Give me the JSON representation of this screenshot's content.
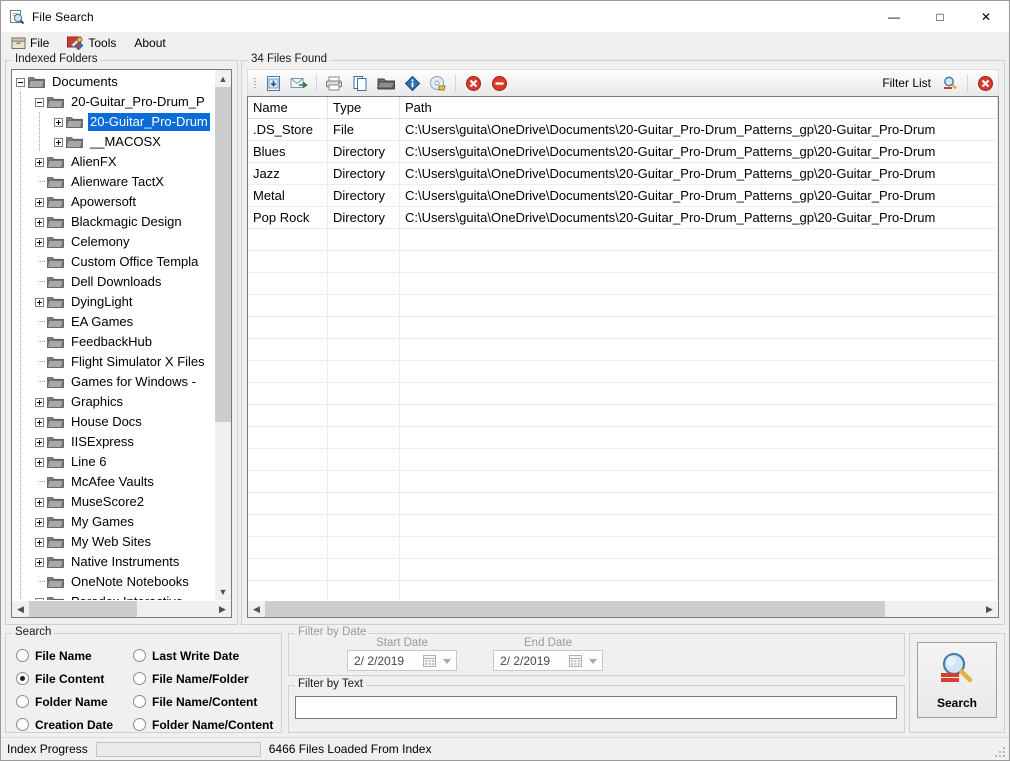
{
  "window": {
    "title": "File Search",
    "icon": "search-document-icon",
    "minimize": "—",
    "maximize": "□",
    "close": "✕"
  },
  "menu": {
    "items": [
      {
        "label": "File",
        "icon": "file-cabinet-icon"
      },
      {
        "label": "Tools",
        "icon": "tools-wrench-icon"
      },
      {
        "label": "About",
        "icon": ""
      }
    ]
  },
  "indexed_folders": {
    "legend": "Indexed Folders",
    "nodes": [
      {
        "label": "Documents",
        "depth": 0,
        "expander": "minus",
        "selected": false
      },
      {
        "label": "20-Guitar_Pro-Drum_P",
        "depth": 1,
        "expander": "minus",
        "selected": false
      },
      {
        "label": "20-Guitar_Pro-Drum",
        "depth": 2,
        "expander": "plus",
        "selected": true
      },
      {
        "label": "__MACOSX",
        "depth": 2,
        "expander": "plus",
        "selected": false
      },
      {
        "label": "AlienFX",
        "depth": 1,
        "expander": "plus",
        "selected": false
      },
      {
        "label": "Alienware TactX",
        "depth": 1,
        "expander": "none",
        "selected": false
      },
      {
        "label": "Apowersoft",
        "depth": 1,
        "expander": "plus",
        "selected": false
      },
      {
        "label": "Blackmagic Design",
        "depth": 1,
        "expander": "plus",
        "selected": false
      },
      {
        "label": "Celemony",
        "depth": 1,
        "expander": "plus",
        "selected": false
      },
      {
        "label": "Custom Office Templa",
        "depth": 1,
        "expander": "none",
        "selected": false
      },
      {
        "label": "Dell Downloads",
        "depth": 1,
        "expander": "none",
        "selected": false
      },
      {
        "label": "DyingLight",
        "depth": 1,
        "expander": "plus",
        "selected": false
      },
      {
        "label": "EA Games",
        "depth": 1,
        "expander": "none",
        "selected": false
      },
      {
        "label": "FeedbackHub",
        "depth": 1,
        "expander": "none",
        "selected": false
      },
      {
        "label": "Flight Simulator X Files",
        "depth": 1,
        "expander": "none",
        "selected": false
      },
      {
        "label": "Games for Windows -",
        "depth": 1,
        "expander": "none",
        "selected": false
      },
      {
        "label": "Graphics",
        "depth": 1,
        "expander": "plus",
        "selected": false
      },
      {
        "label": "House Docs",
        "depth": 1,
        "expander": "plus",
        "selected": false
      },
      {
        "label": "IISExpress",
        "depth": 1,
        "expander": "plus",
        "selected": false
      },
      {
        "label": "Line 6",
        "depth": 1,
        "expander": "plus",
        "selected": false
      },
      {
        "label": "McAfee Vaults",
        "depth": 1,
        "expander": "none",
        "selected": false
      },
      {
        "label": "MuseScore2",
        "depth": 1,
        "expander": "plus",
        "selected": false
      },
      {
        "label": "My Games",
        "depth": 1,
        "expander": "plus",
        "selected": false
      },
      {
        "label": "My Web Sites",
        "depth": 1,
        "expander": "plus",
        "selected": false
      },
      {
        "label": "Native Instruments",
        "depth": 1,
        "expander": "plus",
        "selected": false
      },
      {
        "label": "OneNote Notebooks",
        "depth": 1,
        "expander": "none",
        "selected": false
      },
      {
        "label": "Paradox Interactive",
        "depth": 1,
        "expander": "plus",
        "selected": false
      }
    ]
  },
  "results": {
    "legend": "34 Files Found",
    "toolbar": {
      "buttons": [
        {
          "name": "export-save-icon"
        },
        {
          "name": "email-send-icon"
        },
        {
          "name": "print-icon"
        },
        {
          "name": "copy-icon"
        },
        {
          "name": "open-folder-icon"
        },
        {
          "name": "properties-info-icon"
        },
        {
          "name": "disc-burn-icon"
        },
        {
          "name": "delete-x-icon"
        },
        {
          "name": "remove-minus-icon"
        }
      ],
      "filter_label": "Filter List",
      "filter_search_icon": "filter-search-icon",
      "filter_clear_icon": "filter-clear-icon"
    },
    "columns": [
      "Name",
      "Type",
      "Path"
    ],
    "rows": [
      {
        "name": ".DS_Store",
        "type": "File",
        "path": "C:\\Users\\guita\\OneDrive\\Documents\\20-Guitar_Pro-Drum_Patterns_gp\\20-Guitar_Pro-Drum"
      },
      {
        "name": "Blues",
        "type": "Directory",
        "path": "C:\\Users\\guita\\OneDrive\\Documents\\20-Guitar_Pro-Drum_Patterns_gp\\20-Guitar_Pro-Drum"
      },
      {
        "name": "Jazz",
        "type": "Directory",
        "path": "C:\\Users\\guita\\OneDrive\\Documents\\20-Guitar_Pro-Drum_Patterns_gp\\20-Guitar_Pro-Drum"
      },
      {
        "name": "Metal",
        "type": "Directory",
        "path": "C:\\Users\\guita\\OneDrive\\Documents\\20-Guitar_Pro-Drum_Patterns_gp\\20-Guitar_Pro-Drum"
      },
      {
        "name": "Pop Rock",
        "type": "Directory",
        "path": "C:\\Users\\guita\\OneDrive\\Documents\\20-Guitar_Pro-Drum_Patterns_gp\\20-Guitar_Pro-Drum"
      }
    ]
  },
  "search": {
    "legend": "Search",
    "options": [
      {
        "label": "File Name",
        "selected": false
      },
      {
        "label": "Last Write Date",
        "selected": false
      },
      {
        "label": "File Content",
        "selected": true
      },
      {
        "label": "File Name/Folder",
        "selected": false
      },
      {
        "label": "Folder Name",
        "selected": false
      },
      {
        "label": "File Name/Content",
        "selected": false
      },
      {
        "label": "Creation Date",
        "selected": false
      },
      {
        "label": "Folder Name/Content",
        "selected": false
      }
    ],
    "button_label": "Search",
    "button_icon": "search-magnifier-icon"
  },
  "filter_by_date": {
    "legend": "Filter by Date",
    "start_label": "Start Date",
    "start_value": "2/  2/2019",
    "end_label": "End Date",
    "end_value": "2/  2/2019",
    "calendar_icon": "calendar-icon"
  },
  "filter_by_text": {
    "legend": "Filter by Text",
    "value": "",
    "placeholder": ""
  },
  "status": {
    "progress_label": "Index Progress",
    "progress_percent": 0,
    "message": "6466 Files Loaded From Index"
  },
  "colors": {
    "selection": "#0a6cd8",
    "window_bg": "#f0f0f0",
    "list_bg": "#ffffff",
    "accent_red": "#d93b29",
    "disabled_text": "#9a9a9a"
  }
}
